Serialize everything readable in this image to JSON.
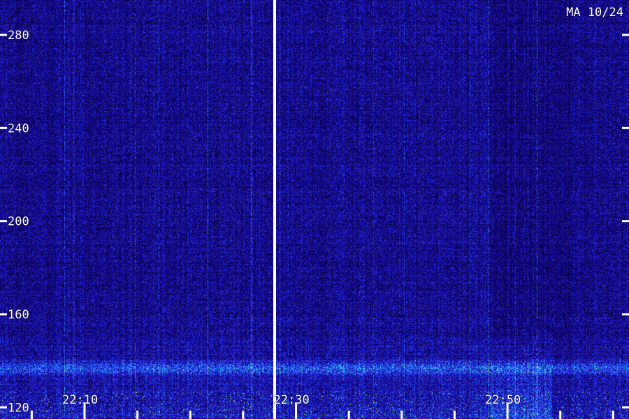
{
  "header": {
    "label": "MA 10/24"
  },
  "colors": {
    "background": "#05003a",
    "low": "#1a0aa0",
    "mid": "#2a3cff",
    "high": "#2ad8ff",
    "peak": "#a8ff40",
    "ticks": "#ffffff"
  },
  "chart_data": {
    "type": "heatmap",
    "y_ticks": [
      {
        "value": 280,
        "label": "280"
      },
      {
        "value": 240,
        "label": "240"
      },
      {
        "value": 200,
        "label": "200"
      },
      {
        "value": 160,
        "label": "160"
      },
      {
        "value": 120,
        "label": "120"
      }
    ],
    "x_labels": [
      {
        "value": 10,
        "label": "22:10"
      },
      {
        "value": 30,
        "label": "22:30"
      },
      {
        "value": 50,
        "label": "22:50"
      }
    ],
    "x_range": [
      2,
      61.5
    ],
    "y_range": [
      115,
      295
    ],
    "x_minor_step": 5,
    "segment_break_at": 28
  }
}
